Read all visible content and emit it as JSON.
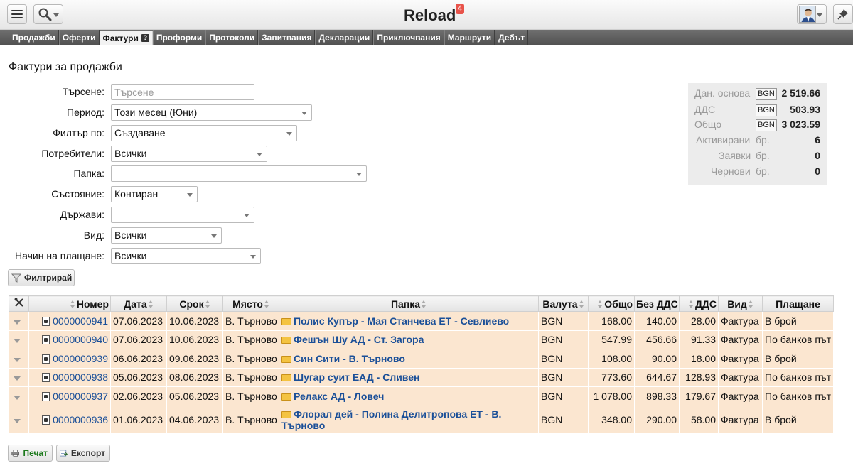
{
  "app": {
    "title": "Reload",
    "notification_count": "4"
  },
  "nav": {
    "tabs": [
      {
        "label": "Продажби"
      },
      {
        "label": "Оферти"
      },
      {
        "label": "Фактури",
        "active": true,
        "help": "?"
      },
      {
        "label": "Проформи"
      },
      {
        "label": "Протоколи"
      },
      {
        "label": "Запитвания"
      },
      {
        "label": "Декларации"
      },
      {
        "label": "Приключвания"
      },
      {
        "label": "Маршрути"
      },
      {
        "label": "Дебът"
      }
    ]
  },
  "page": {
    "title": "Фактури за продажби"
  },
  "filters": {
    "search_label": "Търсене:",
    "search_placeholder": "Търсене",
    "search_value": "",
    "period_label": "Период:",
    "period_value": "Този месец (Юни)",
    "filter_by_label": "Филтър по:",
    "filter_by_value": "Създаване",
    "users_label": "Потребители:",
    "users_value": "Всички",
    "folder_label": "Папка:",
    "folder_value": "",
    "state_label": "Състояние:",
    "state_value": "Контиран",
    "countries_label": "Държави:",
    "countries_value": "",
    "type_label": "Вид:",
    "type_value": "Всички",
    "payment_label": "Начин на плащане:",
    "payment_value": "Всички",
    "filter_button": "Филтрирай"
  },
  "summary": {
    "tax_base_label": "Дан. основа",
    "tax_base_currency": "BGN",
    "tax_base_value": "2 519.66",
    "vat_label": "ДДС",
    "vat_currency": "BGN",
    "vat_value": "503.93",
    "total_label": "Общо",
    "total_currency": "BGN",
    "total_value": "3 023.59",
    "active_label": "Активирани",
    "active_unit": "бр.",
    "active_value": "6",
    "requests_label": "Заявки",
    "requests_unit": "бр.",
    "requests_value": "0",
    "drafts_label": "Чернови",
    "drafts_unit": "бр.",
    "drafts_value": "0"
  },
  "table": {
    "headers": {
      "number": "Номер",
      "date": "Дата",
      "due": "Срок",
      "place": "Място",
      "folder": "Папка",
      "currency": "Валута",
      "total": "Общо",
      "net": "Без ДДС",
      "vat": "ДДС",
      "type": "Вид",
      "payment": "Плащане"
    },
    "rows": [
      {
        "number": "0000000941",
        "date": "07.06.2023",
        "due": "10.06.2023",
        "place": "В. Търново",
        "folder": "Полис Купър - Мая Станчева ЕТ - Севлиево",
        "currency": "BGN",
        "total": "168.00",
        "net": "140.00",
        "vat": "28.00",
        "type": "Фактура",
        "payment": "В брой"
      },
      {
        "number": "0000000940",
        "date": "07.06.2023",
        "due": "10.06.2023",
        "place": "В. Търново",
        "folder": "Фешън Шу АД - Ст. Загора",
        "currency": "BGN",
        "total": "547.99",
        "net": "456.66",
        "vat": "91.33",
        "type": "Фактура",
        "payment": "По банков път"
      },
      {
        "number": "0000000939",
        "date": "06.06.2023",
        "due": "09.06.2023",
        "place": "В. Търново",
        "folder": "Син Сити - В. Търново",
        "currency": "BGN",
        "total": "108.00",
        "net": "90.00",
        "vat": "18.00",
        "type": "Фактура",
        "payment": "В брой"
      },
      {
        "number": "0000000938",
        "date": "05.06.2023",
        "due": "08.06.2023",
        "place": "В. Търново",
        "folder": "Шугар суит ЕАД - Сливен",
        "currency": "BGN",
        "total": "773.60",
        "net": "644.67",
        "vat": "128.93",
        "type": "Фактура",
        "payment": "По банков път"
      },
      {
        "number": "0000000937",
        "date": "02.06.2023",
        "due": "05.06.2023",
        "place": "В. Търново",
        "folder": "Релакс АД - Ловеч",
        "currency": "BGN",
        "total": "1 078.00",
        "net": "898.33",
        "vat": "179.67",
        "type": "Фактура",
        "payment": "По банков път"
      },
      {
        "number": "0000000936",
        "date": "01.06.2023",
        "due": "04.06.2023",
        "place": "В. Търново",
        "folder": "Флорал дей - Полина Делитропова ЕТ - В. Търново",
        "currency": "BGN",
        "total": "348.00",
        "net": "290.00",
        "vat": "58.00",
        "type": "Фактура",
        "payment": "В брой"
      }
    ]
  },
  "actions": {
    "print_label": "Печат",
    "export_label": "Експорт"
  },
  "icons": [
    "menu-icon",
    "search-icon",
    "user-avatar-icon",
    "pin-icon",
    "funnel-icon",
    "tools-icon",
    "document-icon",
    "folder-icon",
    "printer-icon",
    "export-icon"
  ]
}
